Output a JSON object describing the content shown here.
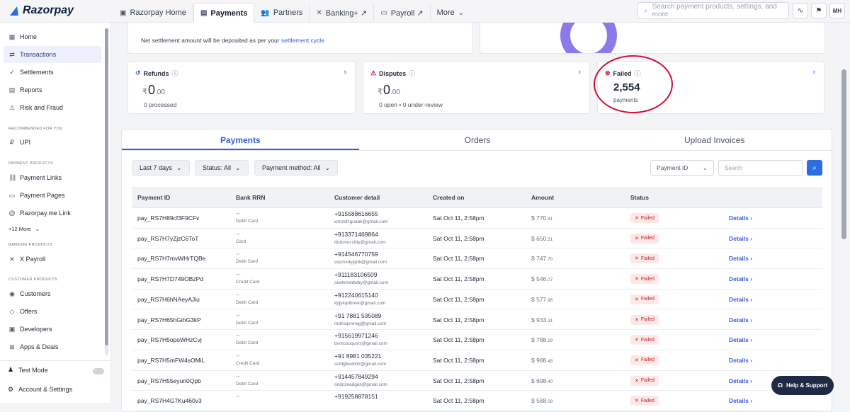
{
  "topbar": {
    "logo": "Razorpay",
    "tabs": [
      {
        "label": "Razorpay Home",
        "icon": "briefcase-icon",
        "active": false
      },
      {
        "label": "Payments",
        "icon": "card-icon",
        "active": true
      },
      {
        "label": "Partners",
        "icon": "people-icon",
        "active": false
      },
      {
        "label": "Banking+ ↗",
        "icon": "x-icon",
        "active": false
      },
      {
        "label": "Payroll ↗",
        "icon": "payroll-icon",
        "active": false
      },
      {
        "label": "More",
        "icon": "chevron-down-icon",
        "active": false
      }
    ],
    "search_placeholder": "Search payment products, settings, and more",
    "avatar": "MH"
  },
  "sidebar": {
    "items": [
      {
        "label": "Home",
        "icon": "home-icon"
      },
      {
        "label": "Transactions",
        "icon": "transfer-icon"
      },
      {
        "label": "Settlements",
        "icon": "check-icon"
      },
      {
        "label": "Reports",
        "icon": "report-icon"
      },
      {
        "label": "Risk and Fraud",
        "icon": "warning-icon"
      }
    ],
    "section_recommended": "Recommended for you",
    "upi": "UPI",
    "section_payment_products": "Payment products",
    "payment_products": [
      "Payment Links",
      "Payment Pages",
      "Razorpay.me Link"
    ],
    "more": "+12 More",
    "section_banking": "Banking products",
    "x_payroll": "X Payroll",
    "section_customer": "Customer products",
    "customer_products": [
      "Customers",
      "Offers",
      "Developers",
      "Apps & Deals"
    ],
    "test_mode": "Test Mode",
    "account_settings": "Account & Settings"
  },
  "settlement": {
    "text": "Net settlement amount will be deposited as per your",
    "link": "settlement cycle"
  },
  "cards": {
    "refunds": {
      "title": "Refunds",
      "amount": "0",
      "decimals": ".00",
      "sub": "0 processed"
    },
    "disputes": {
      "title": "Disputes",
      "amount": "0",
      "decimals": ".00",
      "sub": "0 open  •  0 under-review"
    },
    "failed": {
      "title": "Failed",
      "count": "2,554",
      "sub": "payments"
    }
  },
  "panel": {
    "tabs": [
      "Payments",
      "Orders",
      "Upload Invoices"
    ],
    "filters": [
      "Last 7 days",
      "Status: All",
      "Payment method: All"
    ],
    "id_select": "Payment ID",
    "search_placeholder": "Search",
    "columns": [
      "Payment ID",
      "Bank RRN",
      "Customer detail",
      "Created on",
      "Amount",
      "Status"
    ],
    "rows": [
      {
        "id": "pay_RS7H89cf3F9CFv",
        "rrn": "--",
        "method": "Debit Card",
        "phone": "+915588616655",
        "email": "wmzdlzguabk@gmail.com",
        "date": "Sat Oct 11, 2:58pm",
        "amount": "$ 770",
        "cents": ".91",
        "status": "Failed",
        "action": "Details"
      },
      {
        "id": "pay_RS7H7yZjzC6ToT",
        "rrn": "--",
        "method": "Card",
        "phone": "+913371469864",
        "email": "tbdxmoccfdy@gmail.com",
        "date": "Sat Oct 11, 2:58pm",
        "amount": "$ 650",
        "cents": ".51",
        "status": "Failed",
        "action": "Details"
      },
      {
        "id": "pay_RS7H7mvWHrTQBe",
        "rrn": "--",
        "method": "Debit Card",
        "phone": "+914546770759",
        "email": "vqsmxdyjqnb@gmail.com",
        "date": "Sat Oct 11, 2:58pm",
        "amount": "$ 747",
        "cents": ".70",
        "status": "Failed",
        "action": "Details"
      },
      {
        "id": "pay_RS7H7D749OBzPd",
        "rrn": "--",
        "method": "Credit Card",
        "phone": "+911183106509",
        "email": "seahmxtdwby@gmail.com",
        "date": "Sat Oct 11, 2:58pm",
        "amount": "$ 546",
        "cents": ".07",
        "status": "Failed",
        "action": "Details"
      },
      {
        "id": "pay_RS7H6hNAeyAJiu",
        "rrn": "--",
        "method": "Debit Card",
        "phone": "+912240615140",
        "email": "kpjykqdbnek@gmail.com",
        "date": "Sat Oct 11, 2:58pm",
        "amount": "$ 577",
        "cents": ".96",
        "status": "Failed",
        "action": "Details"
      },
      {
        "id": "pay_RS7H65hGihG3kP",
        "rrn": "--",
        "method": "Debit Card",
        "phone": "+91 7881 535089",
        "email": "mdzoqvrengj@gmail.com",
        "date": "Sat Oct 11, 2:58pm",
        "amount": "$ 933",
        "cents": ".31",
        "status": "Failed",
        "action": "Details"
      },
      {
        "id": "pay_RS7H5opoWHzCvj",
        "rrn": "--",
        "method": "Debit Card",
        "phone": "+915619971246",
        "email": "bnmcouqvsrz@gmail.com",
        "date": "Sat Oct 11, 2:58pm",
        "amount": "$ 788",
        "cents": ".29",
        "status": "Failed",
        "action": "Details"
      },
      {
        "id": "pay_RS7H5mFW4sOMiL",
        "rrn": "--",
        "method": "Credit Card",
        "phone": "+91 8981 035221",
        "email": "sufdgbexbdz@gmail.com",
        "date": "Sat Oct 11, 2:58pm",
        "amount": "$ 988",
        "cents": ".48",
        "status": "Failed",
        "action": "Details"
      },
      {
        "id": "pay_RS7H55eyun0Qpb",
        "rrn": "--",
        "method": "Debit Card",
        "phone": "+914457849294",
        "email": "ondczeadgas@gmail.com",
        "date": "Sat Oct 11, 2:58pm",
        "amount": "$ 698",
        "cents": ".40",
        "status": "Failed",
        "action": "Details"
      },
      {
        "id": "pay_RS7H4G7Ku460v3",
        "rrn": "--",
        "method": "",
        "phone": "+919258878151",
        "email": "",
        "date": "Sat Oct 11, 2:58pm",
        "amount": "$ 588",
        "cents": ".08",
        "status": "Failed",
        "action": "Details"
      }
    ]
  },
  "help": "Help & Support",
  "colors": {
    "accent": "#3b5bdb",
    "failed": "#c81e1e",
    "annotation": "#d0103a"
  }
}
